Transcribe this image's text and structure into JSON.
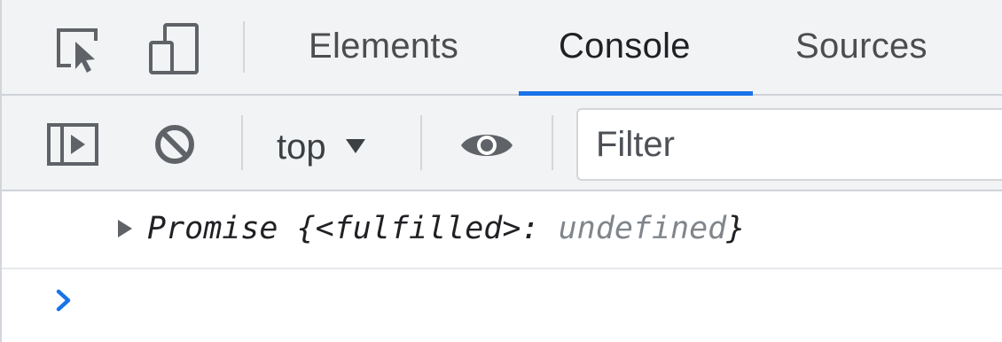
{
  "tabs": {
    "elements": "Elements",
    "console": "Console",
    "sources": "Sources",
    "active": "Console"
  },
  "toolbar": {
    "context": "top",
    "filter_placeholder": "Filter"
  },
  "console": {
    "entry": {
      "prefix": "Promise {",
      "state": "<fulfilled>",
      "separator": ": ",
      "value": "undefined",
      "suffix": "}"
    }
  },
  "colors": {
    "accent": "#1a73e8",
    "toolbar_bg": "#f1f3f4"
  },
  "icons": {
    "inspect": "inspect-element-icon",
    "device": "device-toggle-icon",
    "sidebar": "show-sidebar-icon",
    "clear": "clear-console-icon",
    "eye": "live-expression-icon",
    "prompt": "prompt-chevron-icon",
    "expand": "expand-arrow-icon"
  }
}
